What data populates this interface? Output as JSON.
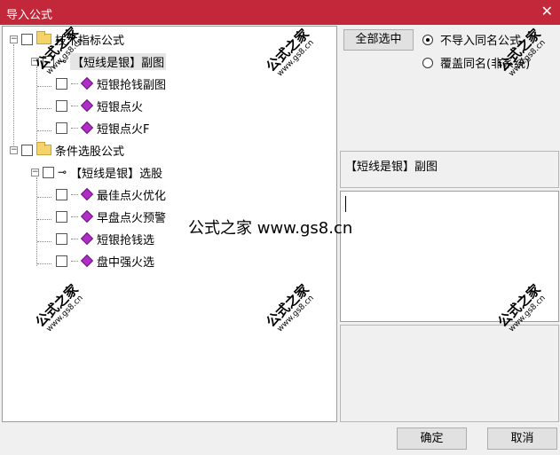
{
  "window": {
    "title": "导入公式",
    "close_glyph": "✕"
  },
  "tree": {
    "root1": {
      "label": "技术指标公式"
    },
    "group1": {
      "label": "【短线是银】副图"
    },
    "items1": [
      "短银抢钱副图",
      "短银点火",
      "短银点火F"
    ],
    "root2": {
      "label": "条件选股公式"
    },
    "group2": {
      "label": "【短线是银】选股"
    },
    "items2": [
      "最佳点火优化",
      "早盘点火预警",
      "短银抢钱选",
      "盘中强火选"
    ]
  },
  "right": {
    "select_all": "全部选中",
    "radio1": "不导入同名公式",
    "radio2": "覆盖同名(非系统)",
    "selected_title": "【短线是银】副图"
  },
  "footer": {
    "ok": "确定",
    "cancel": "取消"
  },
  "watermark": {
    "brand": "公式之家",
    "url": "www.gs8.cn",
    "center": "公式之家 www.gs8.cn"
  }
}
